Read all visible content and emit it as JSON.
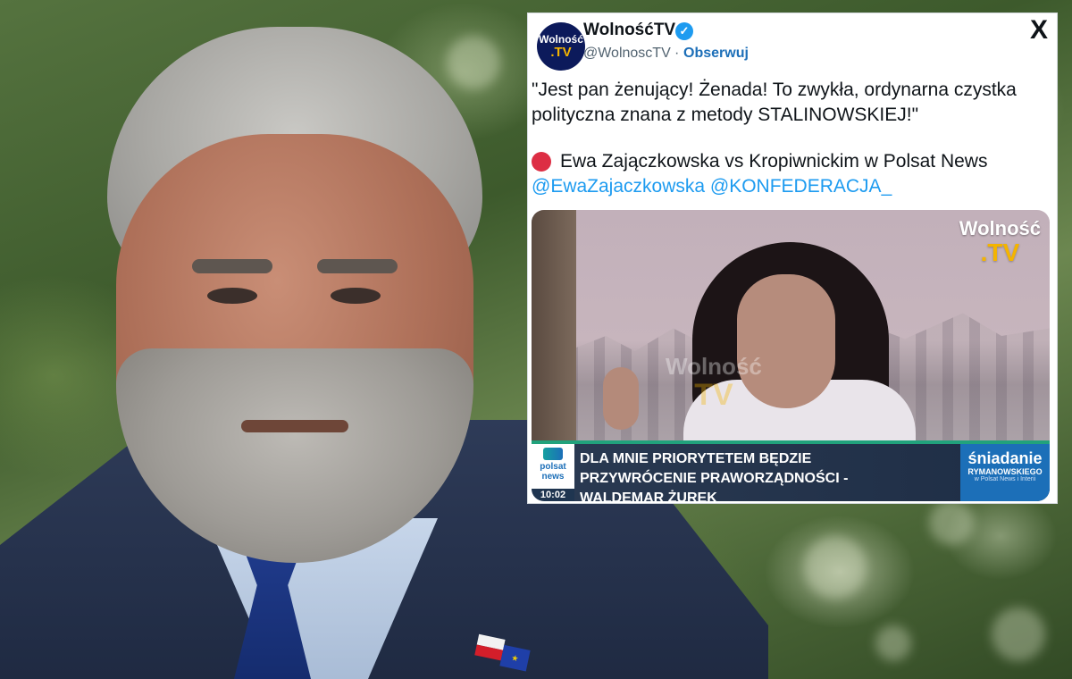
{
  "tweet": {
    "avatar": {
      "line1": "Wolność",
      "line2": ".TV"
    },
    "author_name": "WolnośćTV",
    "verified_icon": "check-icon",
    "handle": "@WolnoscTV",
    "separator": "·",
    "follow_label": "Obserwuj",
    "close_icon": "X",
    "text": "\"Jest pan żenujący! Żenada! To zwykła, ordynarna czystka polityczna znana z metody STALINOWSKIEJ!\"",
    "line2_icon": "red-circle-icon",
    "line2": "Ewa Zajączkowska vs Kropiwnickim w Polsat News",
    "mentions": [
      "@EwaZajaczkowska",
      "@KONFEDERACJA_"
    ]
  },
  "video": {
    "watermark_top": {
      "line1": "Wolność",
      "line2": ".TV"
    },
    "watermark_mid": {
      "line1": "Wolność",
      "line2": "TV"
    },
    "channel_logo": "polsat news",
    "clock": "10:02",
    "headline": "DLA MNIE PRIORYTETEM BĘDZIE PRZYWRÓCENIE PRAWORZĄDNOŚCI - WALDEMAR ŻUREK",
    "show": {
      "title": "śniadanie",
      "subtitle": "RYMANOWSKIEGO",
      "note": "w Polsat News i Interii"
    }
  },
  "photo": {
    "pin_eu_stars": "★"
  }
}
